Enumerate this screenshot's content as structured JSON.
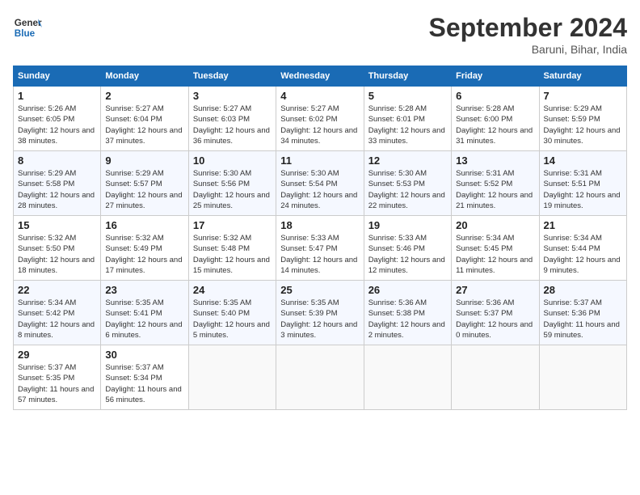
{
  "header": {
    "logo_line1": "General",
    "logo_line2": "Blue",
    "month_title": "September 2024",
    "subtitle": "Baruni, Bihar, India"
  },
  "weekdays": [
    "Sunday",
    "Monday",
    "Tuesday",
    "Wednesday",
    "Thursday",
    "Friday",
    "Saturday"
  ],
  "weeks": [
    [
      {
        "day": 1,
        "sunrise": "5:26 AM",
        "sunset": "6:05 PM",
        "daylight": "12 hours and 38 minutes."
      },
      {
        "day": 2,
        "sunrise": "5:27 AM",
        "sunset": "6:04 PM",
        "daylight": "12 hours and 37 minutes."
      },
      {
        "day": 3,
        "sunrise": "5:27 AM",
        "sunset": "6:03 PM",
        "daylight": "12 hours and 36 minutes."
      },
      {
        "day": 4,
        "sunrise": "5:27 AM",
        "sunset": "6:02 PM",
        "daylight": "12 hours and 34 minutes."
      },
      {
        "day": 5,
        "sunrise": "5:28 AM",
        "sunset": "6:01 PM",
        "daylight": "12 hours and 33 minutes."
      },
      {
        "day": 6,
        "sunrise": "5:28 AM",
        "sunset": "6:00 PM",
        "daylight": "12 hours and 31 minutes."
      },
      {
        "day": 7,
        "sunrise": "5:29 AM",
        "sunset": "5:59 PM",
        "daylight": "12 hours and 30 minutes."
      }
    ],
    [
      {
        "day": 8,
        "sunrise": "5:29 AM",
        "sunset": "5:58 PM",
        "daylight": "12 hours and 28 minutes."
      },
      {
        "day": 9,
        "sunrise": "5:29 AM",
        "sunset": "5:57 PM",
        "daylight": "12 hours and 27 minutes."
      },
      {
        "day": 10,
        "sunrise": "5:30 AM",
        "sunset": "5:56 PM",
        "daylight": "12 hours and 25 minutes."
      },
      {
        "day": 11,
        "sunrise": "5:30 AM",
        "sunset": "5:54 PM",
        "daylight": "12 hours and 24 minutes."
      },
      {
        "day": 12,
        "sunrise": "5:30 AM",
        "sunset": "5:53 PM",
        "daylight": "12 hours and 22 minutes."
      },
      {
        "day": 13,
        "sunrise": "5:31 AM",
        "sunset": "5:52 PM",
        "daylight": "12 hours and 21 minutes."
      },
      {
        "day": 14,
        "sunrise": "5:31 AM",
        "sunset": "5:51 PM",
        "daylight": "12 hours and 19 minutes."
      }
    ],
    [
      {
        "day": 15,
        "sunrise": "5:32 AM",
        "sunset": "5:50 PM",
        "daylight": "12 hours and 18 minutes."
      },
      {
        "day": 16,
        "sunrise": "5:32 AM",
        "sunset": "5:49 PM",
        "daylight": "12 hours and 17 minutes."
      },
      {
        "day": 17,
        "sunrise": "5:32 AM",
        "sunset": "5:48 PM",
        "daylight": "12 hours and 15 minutes."
      },
      {
        "day": 18,
        "sunrise": "5:33 AM",
        "sunset": "5:47 PM",
        "daylight": "12 hours and 14 minutes."
      },
      {
        "day": 19,
        "sunrise": "5:33 AM",
        "sunset": "5:46 PM",
        "daylight": "12 hours and 12 minutes."
      },
      {
        "day": 20,
        "sunrise": "5:34 AM",
        "sunset": "5:45 PM",
        "daylight": "12 hours and 11 minutes."
      },
      {
        "day": 21,
        "sunrise": "5:34 AM",
        "sunset": "5:44 PM",
        "daylight": "12 hours and 9 minutes."
      }
    ],
    [
      {
        "day": 22,
        "sunrise": "5:34 AM",
        "sunset": "5:42 PM",
        "daylight": "12 hours and 8 minutes."
      },
      {
        "day": 23,
        "sunrise": "5:35 AM",
        "sunset": "5:41 PM",
        "daylight": "12 hours and 6 minutes."
      },
      {
        "day": 24,
        "sunrise": "5:35 AM",
        "sunset": "5:40 PM",
        "daylight": "12 hours and 5 minutes."
      },
      {
        "day": 25,
        "sunrise": "5:35 AM",
        "sunset": "5:39 PM",
        "daylight": "12 hours and 3 minutes."
      },
      {
        "day": 26,
        "sunrise": "5:36 AM",
        "sunset": "5:38 PM",
        "daylight": "12 hours and 2 minutes."
      },
      {
        "day": 27,
        "sunrise": "5:36 AM",
        "sunset": "5:37 PM",
        "daylight": "12 hours and 0 minutes."
      },
      {
        "day": 28,
        "sunrise": "5:37 AM",
        "sunset": "5:36 PM",
        "daylight": "11 hours and 59 minutes."
      }
    ],
    [
      {
        "day": 29,
        "sunrise": "5:37 AM",
        "sunset": "5:35 PM",
        "daylight": "11 hours and 57 minutes."
      },
      {
        "day": 30,
        "sunrise": "5:37 AM",
        "sunset": "5:34 PM",
        "daylight": "11 hours and 56 minutes."
      },
      null,
      null,
      null,
      null,
      null
    ]
  ]
}
